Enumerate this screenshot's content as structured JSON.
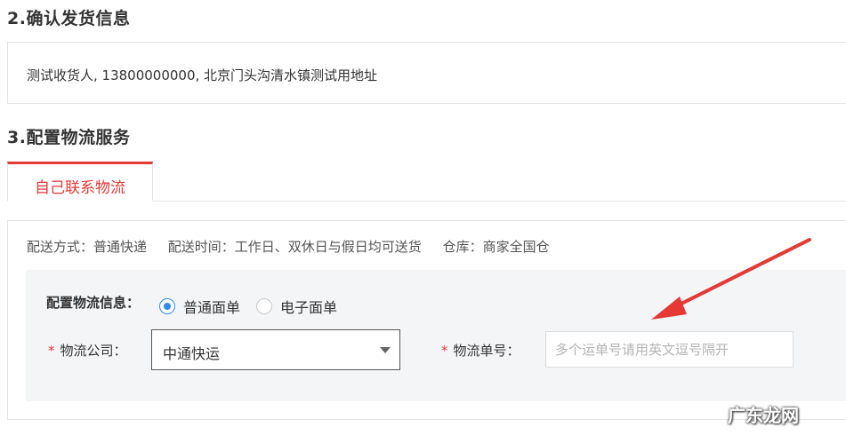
{
  "confirm_shipping": {
    "title": "2.确认发货信息",
    "info": "测试收货人, 13800000000, 北京门头沟清水镇测试用地址"
  },
  "logistics": {
    "title": "3.配置物流服务",
    "tab_label": "自己联系物流",
    "delivery_method": "配送方式：普通快递",
    "delivery_time": "配送时间：工作日、双休日与假日均可送货",
    "warehouse": "仓库：商家全国仓",
    "config_label": "配置物流信息：",
    "radio_normal": "普通面单",
    "radio_electronic": "电子面单",
    "company_label": "物流公司：",
    "company_value": "中通快运",
    "tracking_label": "物流单号：",
    "tracking_placeholder": "多个运单号请用英文逗号隔开",
    "required_mark": "*"
  },
  "colors": {
    "accent_red": "#e53935",
    "radio_blue": "#2d8cf0",
    "config_bg": "#f4f5f7"
  },
  "watermark": "广东龙网"
}
